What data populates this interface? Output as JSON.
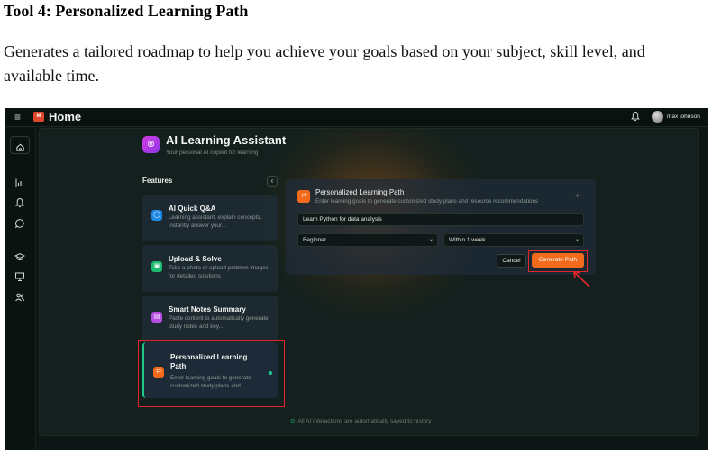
{
  "doc": {
    "title": "Tool 4: Personalized Learning Path",
    "description": "Generates a tailored roadmap to help you achieve your goals based on your subject, skill level, and available time."
  },
  "app": {
    "menu_icon": "≡",
    "logo_text": "M",
    "home_title": "Home",
    "username": "max johnson",
    "icons": [
      "menu-icon",
      "bell-icon",
      "avatar"
    ]
  },
  "sidebar": {
    "icons": [
      "home-icon",
      "chart-icon",
      "bell-icon",
      "chat-icon",
      "graduation-cap-icon",
      "monitor-icon",
      "users-icon"
    ]
  },
  "assistant": {
    "title": "AI Learning Assistant",
    "subtitle": "Your personal AI copilot for learning"
  },
  "features": {
    "label": "Features",
    "collapse_glyph": "‹",
    "cards": [
      {
        "title": "AI Quick Q&A",
        "desc": "Learning assistant, explain concepts, instantly answer your...",
        "icon": "chat-bubble-icon",
        "color": "#1e88e5"
      },
      {
        "title": "Upload & Solve",
        "desc": "Take a photo or upload problem images for detailed solutions",
        "icon": "image-upload-icon",
        "color": "#1fba6e"
      },
      {
        "title": "Smart Notes Summary",
        "desc": "Paste content to automatically generate study notes and key...",
        "icon": "notes-icon",
        "color": "#b84fe0"
      },
      {
        "title": "Personalized Learning Path",
        "desc": "Enter learning goals to generate customized study plans and...",
        "icon": "path-icon",
        "color": "#f26b1d"
      }
    ]
  },
  "panel": {
    "title": "Personalized Learning Path",
    "subtitle": "Enter learning goals to generate customized study plans and resource recommendations",
    "plus": "+",
    "goal_value": "Learn Python for data analysis",
    "level_selected": "Beginner",
    "time_selected": "Within 1 week",
    "cancel_label": "Cancel",
    "generate_label": "Generate Path"
  },
  "footer": {
    "note": "All AI interactions are automatically saved to history"
  },
  "colors": {
    "accent_orange": "#f26b1d",
    "accent_green": "#20c98a",
    "highlight_red": "#e3262b"
  }
}
